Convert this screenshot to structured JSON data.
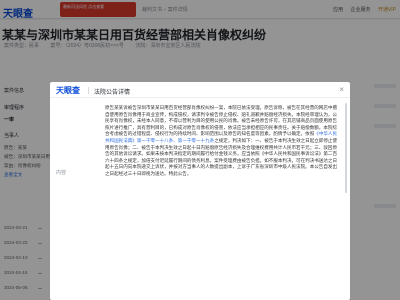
{
  "app": {
    "logo": "天眼查",
    "ad_banner": "最新司法风险 点击查看",
    "breadcrumb": [
      "裁判文书",
      "案件详情"
    ],
    "topnav": [
      "应用",
      "企业服务",
      "开通VIP"
    ]
  },
  "page": {
    "title": "某某与深圳市某某日用百货经营部相关肖像权纠纷",
    "meta": [
      "案件类型：民事",
      "案号：（2024）粤0306民初×××号",
      "法院：深圳市宝安区人民法院"
    ],
    "section_title": "案件信息",
    "labels": [
      "审理程序",
      "一审",
      "当事人"
    ],
    "lines": [
      "原告：某某",
      "被告：深圳市某某日用百货经营部",
      "案由：肖像权纠纷",
      "查看全文"
    ],
    "timeline_dates": [
      "2024-03-21",
      "2024-03-22",
      "2024-04-10",
      "2024-04-18",
      "2024-05-06",
      "2024-05-20"
    ]
  },
  "modal": {
    "logo": "天眼查",
    "title": "法院公告详情",
    "close": "×",
    "field_label": "内容",
    "content_pre": "原告某某诉被告深圳市某某日用百货经营部肖像权纠纷一案，本院已依法受理。原告诉称，被告在其经营的网店中擅自使用原告肖像用于商业宣传，构成侵权，请求判令被告停止侵权、赔礼道歉并赔偿经济损失。本院经审理认为，公民享有肖像权，未经本人同意，不得以营利为目的使用公民的肖像。被告未经原告许可，在其店铺商品页面使用原告照片进行推广，具有营利目的，已构成对原告肖像权的侵害，依法应当承担相应的民事责任。关于赔偿数额，本院综合考虑被告的过错程度、侵权行为的持续时间、影响范围以及原告的知名度等因素，酌情予以确定。依照",
    "content_link": "《中华人民共和国民法典》第一千零一十八条、第一千零一十九条",
    "content_post": "之规定，判决如下：一、被告于本判决生效之日起立即停止使用原告肖像；二、被告于本判决生效之日起十日内赔偿原告经济损失及合理维权费用共计人民币若干元；三、驳回原告的其他诉讼请求。如果未按本判决指定的期间履行给付金钱义务，应当依照《中华人民共和国民事诉讼法》第二百六十四条之规定，加倍支付迟延履行期间的债务利息。案件受理费由被告负担。如不服本判决，可在判决书送达之日起十五日内向本院递交上诉状，并按对方当事人的人数提出副本，上诉于广东省深圳市中级人民法院。本公告自发出之日起经过三十日即视为送达。特此公告。"
  }
}
